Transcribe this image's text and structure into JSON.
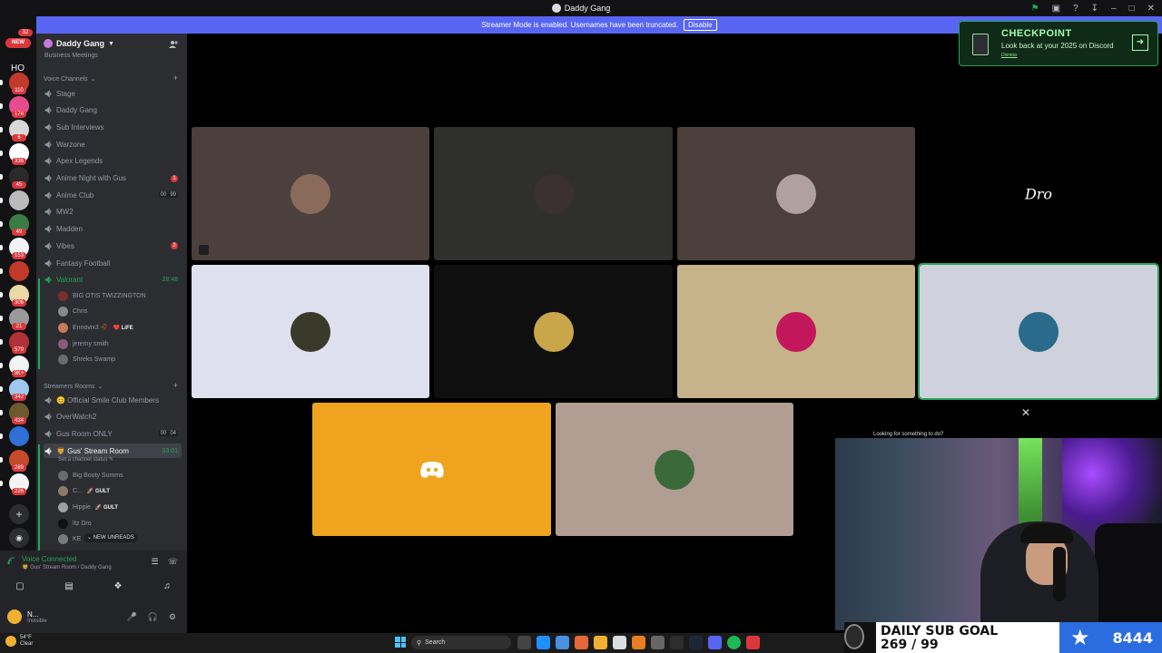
{
  "window": {
    "title": "Daddy Gang"
  },
  "banner": {
    "text": "Streamer Mode is enabled. Usernames have been truncated.",
    "button": "Disable"
  },
  "rail": {
    "new_label": "NEW",
    "new_count": "32",
    "home_label": "HO",
    "servers": [
      {
        "badge": "110",
        "color": "#c0392b"
      },
      {
        "badge": "174",
        "color": "#e74c8c"
      },
      {
        "badge": "6",
        "color": "#d8d8d8"
      },
      {
        "badge": "336",
        "color": "#ffffff"
      },
      {
        "badge": "45",
        "color": "#2a2a2a"
      },
      {
        "badge": "",
        "color": "#bbbbbb"
      },
      {
        "badge": "49",
        "color": "#3a7d44"
      },
      {
        "badge": "153",
        "color": "#f2f3f5"
      },
      {
        "badge": "",
        "color": "#c0392b"
      },
      {
        "badge": "306",
        "color": "#e8d9a6"
      },
      {
        "badge": "21",
        "color": "#999999"
      },
      {
        "badge": "579",
        "color": "#b0303a"
      },
      {
        "badge": "3K+",
        "color": "#f2f3f5"
      },
      {
        "badge": "342",
        "color": "#9fc8f0"
      },
      {
        "badge": "434",
        "color": "#6b5a2e"
      },
      {
        "badge": "",
        "color": "#2f6fd6"
      },
      {
        "badge": "289",
        "color": "#c44a2a"
      },
      {
        "badge": "226",
        "color": "#f2f3f5"
      }
    ]
  },
  "sidebar": {
    "server_name": "Daddy Gang",
    "partial_top": "Business Meetings",
    "voice_category": "Voice Channels",
    "streamers_category": "Streamers Rooms",
    "channels": [
      {
        "name": "Stage"
      },
      {
        "name": "Daddy Gang"
      },
      {
        "name": "Sub Interviews"
      },
      {
        "name": "Warzone"
      },
      {
        "name": "Apex Legends"
      },
      {
        "name": "Anime Night with Gus",
        "badge": "1"
      },
      {
        "name": "Anime Club",
        "users": [
          "00",
          "99"
        ]
      },
      {
        "name": "MW2"
      },
      {
        "name": "Madden"
      },
      {
        "name": "Vibes",
        "badge": "2"
      },
      {
        "name": "Fantasy Football"
      },
      {
        "name": "Valorant",
        "timer": "28:48"
      }
    ],
    "valorant_members": [
      {
        "name": "BIG OTIS TWIZZINGTON",
        "color": "#7a2e2e"
      },
      {
        "name": "Chris",
        "color": "#888888"
      },
      {
        "name": "Ennovix3 🥀",
        "tag": "❤️ LiFE",
        "color": "#c77a5a"
      },
      {
        "name": "jeremy smith",
        "color": "#8a5a7a"
      },
      {
        "name": "Shreks Swamp",
        "color": "#6a6a6a"
      }
    ],
    "streamer_channels": [
      {
        "name": "😊 Official Smile Club Members"
      },
      {
        "name": "OverWatch2"
      },
      {
        "name": "Gus Room ONLY",
        "users": [
          "00",
          "04"
        ]
      },
      {
        "name": "🦁 Gus' Stream Room",
        "timer": "33:01"
      }
    ],
    "channel_status": "Set a channel status ✎",
    "stream_members": [
      {
        "name": "Big Booty Summs",
        "color": "#6a6a6a"
      },
      {
        "name": "C...",
        "tag": "🚀 GULT",
        "color": "#8a7a6a"
      },
      {
        "name": "Hippie",
        "tag": "🚀 GULT",
        "color": "#a0a0a0"
      },
      {
        "name": "Itz Dro",
        "color": "#111111"
      },
      {
        "name": "KE",
        "color": "#7a7a7a"
      }
    ],
    "new_unreads": "NEW UNREADS"
  },
  "voice": {
    "status": "Voice Connected",
    "location": "🦁 Gus' Stream Room / Daddy Gang"
  },
  "user": {
    "name": "N...",
    "status": "Invisible"
  },
  "tiles": [
    {
      "bg": "#4b403d",
      "avatar": "#8a6a5a"
    },
    {
      "bg": "#2f2f2d",
      "avatar": "#3a3030"
    },
    {
      "bg": "#4a3f3b",
      "avatar": "#b0a0a0"
    },
    {
      "bg": "#000000",
      "avatar": "",
      "label": "Dro"
    },
    {
      "bg": "#dfe0ef",
      "avatar": "#3a3a2a"
    },
    {
      "bg": "#0f0f0f",
      "avatar": "#c9a64a"
    },
    {
      "bg": "#c6b38a",
      "avatar": "#c2185b"
    },
    {
      "bg": "#cfd2dc",
      "avatar": "#2a6a8a"
    },
    {
      "bg": "#f0a31e",
      "avatar": ""
    },
    {
      "bg": "#b19d91",
      "avatar": "#3a6a3a"
    }
  ],
  "checkpoint": {
    "title": "CHECKPOINT",
    "subtitle": "Look back at your 2025 on Discord",
    "dismiss": "Dismiss"
  },
  "webcam_hint": "Looking for something to do?",
  "subgoal": {
    "title": "DAILY SUB GOAL",
    "progress": "269 / 99",
    "count": "8444"
  },
  "taskbar": {
    "temp": "54°F",
    "condition": "Clear",
    "search": "Search"
  }
}
